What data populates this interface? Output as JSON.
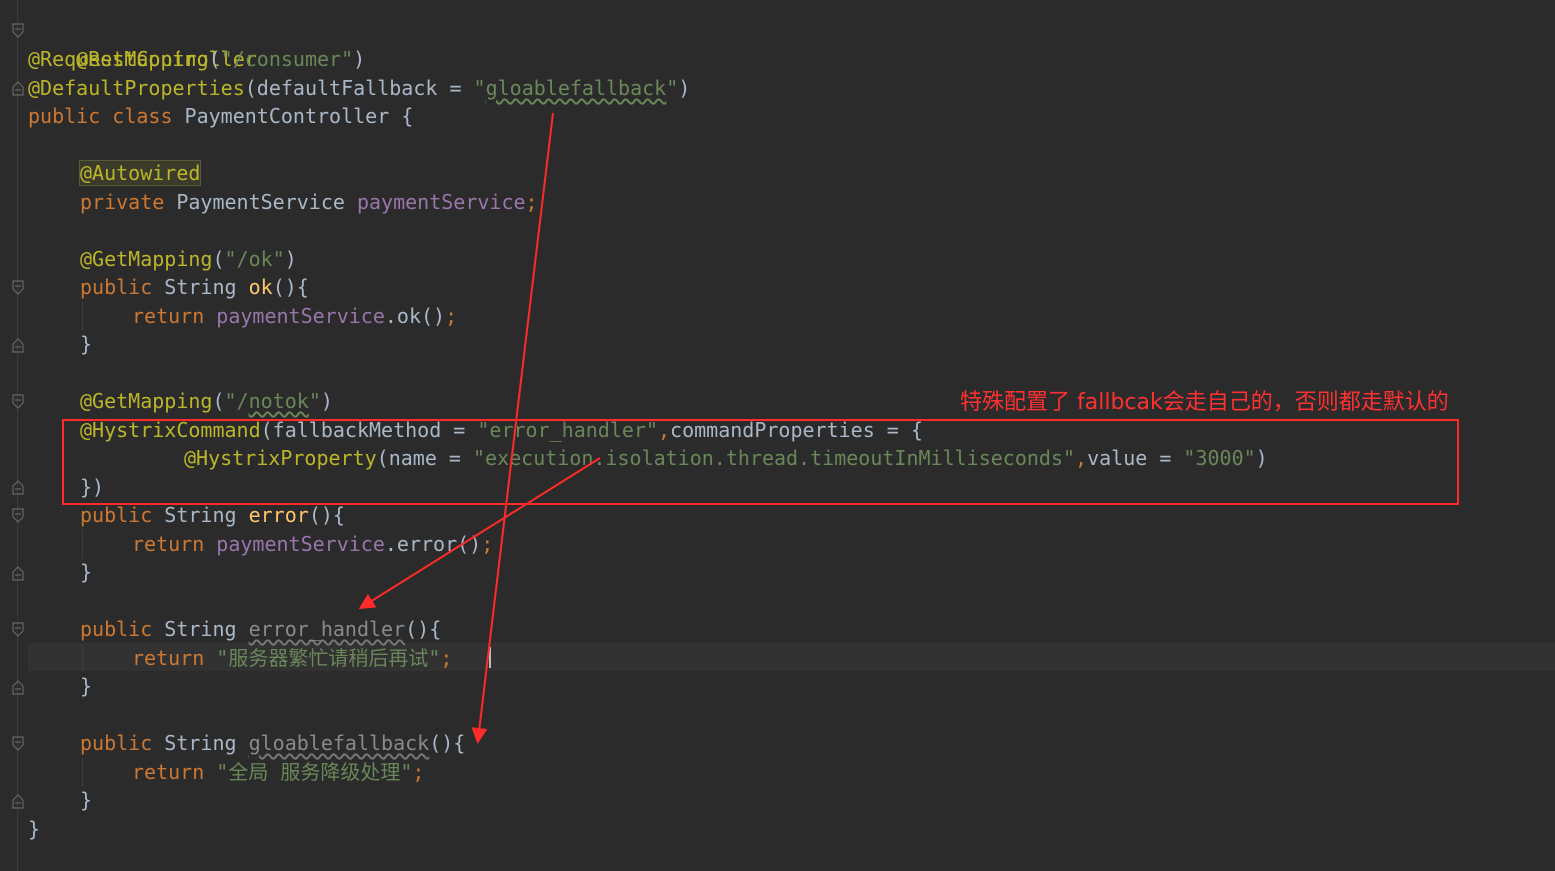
{
  "code": {
    "l1_ann": "@RestController",
    "l2_ann": "@RequestMapping",
    "l2_open": "(",
    "l2_str": "\"/consumer\"",
    "l2_close": ")",
    "l3_ann": "@DefaultProperties",
    "l3_open": "(defaultFallback = ",
    "l3_q1": "\"",
    "l3_strval": "gloablefallback",
    "l3_q2": "\"",
    "l3_close": ")",
    "l4_kw": "public class ",
    "l4_rest": "PaymentController {",
    "l6_ann": "@Autowired",
    "l7_kw": "private ",
    "l7_type": "PaymentService ",
    "l7_fld": "paymentService",
    "l7_semi": ";",
    "l9_ann": "@GetMapping",
    "l9_open": "(",
    "l9_str": "\"/ok\"",
    "l9_close": ")",
    "l10_kw": "public ",
    "l10_type": "String ",
    "l10_fn": "ok",
    "l10_rest": "(){",
    "l11_kw": "return ",
    "l11_fld": "paymentService",
    "l11_rest": ".ok()",
    "l11_semi": ";",
    "close_brace": "}",
    "l14_ann": "@GetMapping",
    "l14_open": "(",
    "l14_q1": "\"/",
    "l14_strval": "notok",
    "l14_q2": "\"",
    "l14_close": ")",
    "l15_ann": "@HystrixCommand",
    "l15_a": "(fallbackMethod = ",
    "l15_str": "\"error_handler\"",
    "l15_comma": ",",
    "l15_b": "commandProperties = {",
    "l16_ann": "@HystrixProperty",
    "l16_a": "(name = ",
    "l16_str": "\"execution.isolation.thread.timeoutInMilliseconds\"",
    "l16_comma": ",",
    "l16_b": "value = ",
    "l16_str2": "\"3000\"",
    "l16_close": ")",
    "l17": "})",
    "l18_kw": "public ",
    "l18_type": "String ",
    "l18_fn": "error",
    "l18_rest": "(){",
    "l19_kw": "return ",
    "l19_fld": "paymentService",
    "l19_rest": ".error()",
    "l19_semi": ";",
    "l22_kw": "public ",
    "l22_type": "String ",
    "l22_fn": "error_handler",
    "l22_rest": "(){",
    "l23_kw": "return ",
    "l23_str": "\"服务器繁忙请稍后再试\"",
    "l23_semi": ";",
    "l26_kw": "public ",
    "l26_type": "String ",
    "l26_fn": "gloablefallback",
    "l26_rest": "(){",
    "l27_kw": "return ",
    "l27_str": "\"全局 服务降级处理\"",
    "l27_semi": ";"
  },
  "annotation_note": "特殊配置了 fallbcak会走自己的，否则都走默认的",
  "colors": {
    "background": "#2b2b2b",
    "annotation": "#bbb529",
    "string": "#6a8759",
    "keyword": "#cc7832",
    "method": "#ffc66d",
    "field": "#9876aa",
    "plain": "#a9b7c6",
    "markup_red": "#ff2a2a"
  }
}
